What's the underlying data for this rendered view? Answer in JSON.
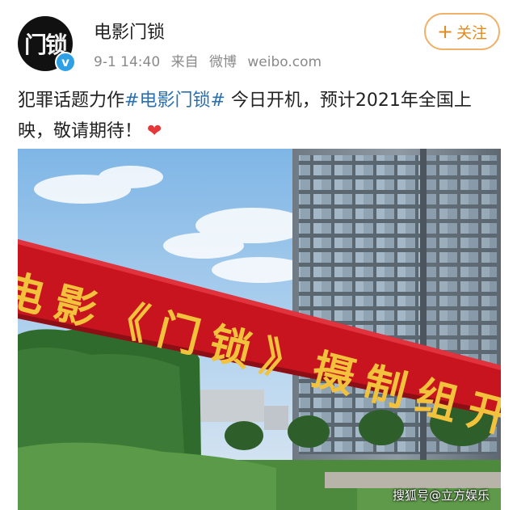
{
  "post": {
    "username": "电影门锁",
    "avatar_text": "门锁",
    "verified_icon": "v",
    "date": "9-1 14:40",
    "source_prefix": "来自",
    "source_app": "微博",
    "source_site": "weibo.com",
    "follow_label": "关注",
    "follow_plus": "+",
    "text_before": "犯罪话题力作",
    "hashtag": "#电影门锁#",
    "text_after": "今日开机，预计2021年全国上映，敬请期待！",
    "heart_icon": "heart-icon"
  },
  "photo": {
    "banner_text": "电影《门锁》摄制组开机",
    "watermark": "搜狐号@立方娱乐"
  },
  "colors": {
    "hashtag": "#2a6fb0",
    "follow": "#e08a1e",
    "banner": "#c8141f",
    "banner_text": "#f3c23d",
    "verified": "#2fa0e6"
  }
}
